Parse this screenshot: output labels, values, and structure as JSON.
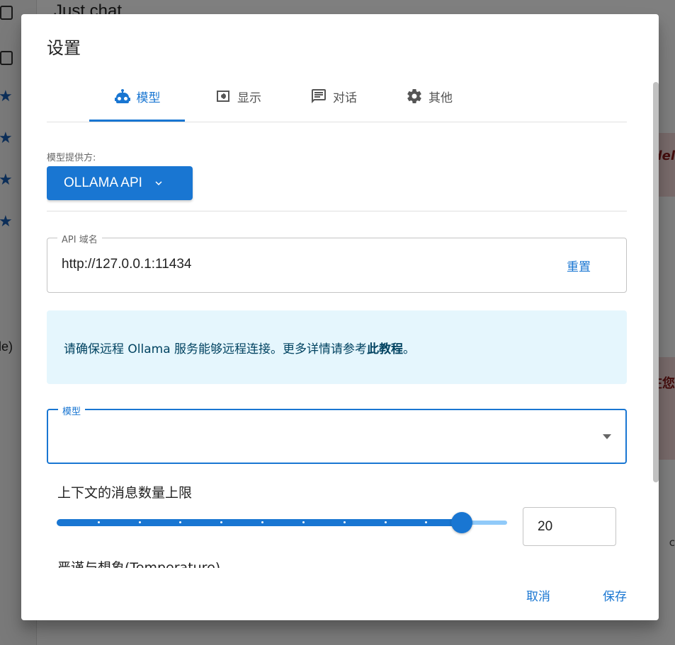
{
  "background": {
    "header_title": "Just chat",
    "sidebar_partial_text": "le)",
    "right_partial_text_1": "del",
    "right_partial_text_2": "在您",
    "right_partial_text_3": "c"
  },
  "dialog": {
    "title": "设置",
    "tabs": [
      {
        "label": "模型",
        "icon": "robot-icon",
        "active": true
      },
      {
        "label": "显示",
        "icon": "display-icon",
        "active": false
      },
      {
        "label": "对话",
        "icon": "chat-icon",
        "active": false
      },
      {
        "label": "其他",
        "icon": "gear-icon",
        "active": false
      }
    ],
    "provider": {
      "label": "模型提供方:",
      "value": "OLLAMA API"
    },
    "api_host": {
      "legend": "API 域名",
      "value": "http://127.0.0.1:11434",
      "reset_label": "重置"
    },
    "alert": {
      "text": "请确保远程 Ollama 服务能够远程连接。更多详情请参考",
      "link": "此教程",
      "suffix": "。"
    },
    "model_select": {
      "legend": "模型",
      "value": ""
    },
    "context_limit": {
      "label": "上下文的消息数量上限",
      "value": "20",
      "fraction": 0.9
    },
    "temperature_label": "严谨与想象(Temperature)",
    "actions": {
      "cancel": "取消",
      "save": "保存"
    },
    "colors": {
      "primary": "#1976d2",
      "alert_bg": "#e5f6fd"
    }
  }
}
